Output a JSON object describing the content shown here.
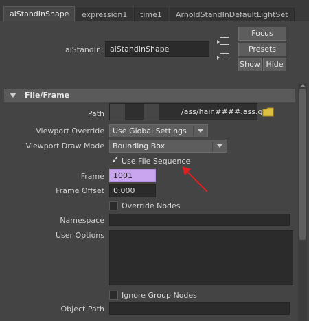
{
  "tabs": [
    {
      "label": "aiStandInShape",
      "active": true
    },
    {
      "label": "expression1",
      "active": false
    },
    {
      "label": "time1",
      "active": false
    },
    {
      "label": "ArnoldStandInDefaultLightSet",
      "active": false
    }
  ],
  "header": {
    "node_label": "aiStandIn:",
    "node_name": "aiStandInShape",
    "focus_label": "Focus",
    "presets_label": "Presets",
    "show_label": "Show",
    "hide_label": "Hide",
    "input_icon": "input-connection-icon",
    "output_icon": "output-connection-icon"
  },
  "section": {
    "title": "File/Frame"
  },
  "fields": {
    "path_label": "Path",
    "path_value": "/ass/hair.####.ass.gz",
    "viewport_override_label": "Viewport Override",
    "viewport_override_value": "Use Global Settings",
    "viewport_draw_label": "Viewport Draw Mode",
    "viewport_draw_value": "Bounding Box",
    "use_file_sequence_label": "Use File Sequence",
    "use_file_sequence_checked": true,
    "frame_label": "Frame",
    "frame_value": "1001",
    "frame_offset_label": "Frame Offset",
    "frame_offset_value": "0.000",
    "override_nodes_label": "Override Nodes",
    "override_nodes_checked": false,
    "namespace_label": "Namespace",
    "namespace_value": "",
    "user_options_label": "User Options",
    "user_options_value": "",
    "ignore_group_nodes_label": "Ignore Group Nodes",
    "ignore_group_nodes_checked": false,
    "object_path_label": "Object Path",
    "object_path_value": ""
  },
  "colors": {
    "frame_field": "#c9a5f0",
    "annotation_arrow": "#e02020"
  }
}
